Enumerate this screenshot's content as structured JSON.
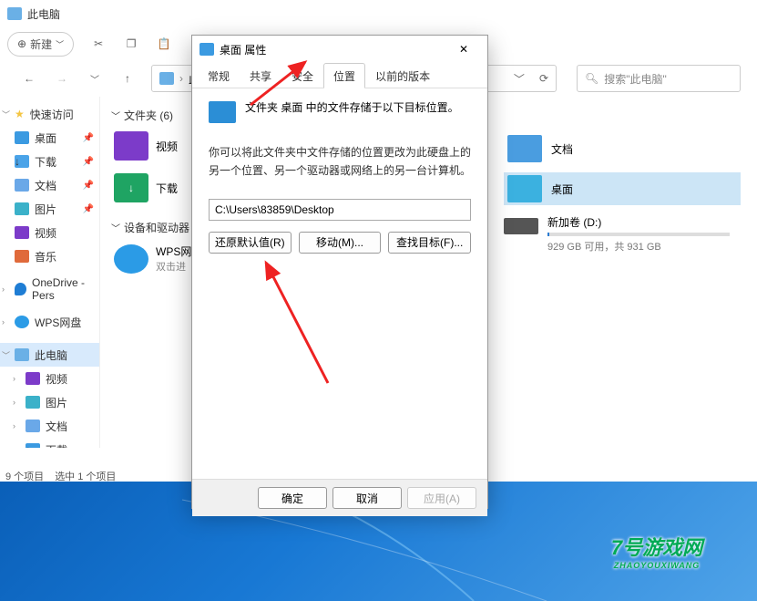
{
  "explorer": {
    "title": "此电脑",
    "new_btn": "新建",
    "breadcrumb": "此电脑",
    "search_placeholder": "搜索\"此电脑\""
  },
  "sidebar": {
    "quick": "快速访问",
    "items": [
      "桌面",
      "下载",
      "文档",
      "图片",
      "视频",
      "音乐"
    ],
    "onedrive": "OneDrive - Pers",
    "wps": "WPS网盘",
    "thispc": "此电脑",
    "sub": [
      "视频",
      "图片",
      "文档",
      "下载"
    ]
  },
  "content": {
    "folders_hdr": "文件夹 (6)",
    "devices_hdr": "设备和驱动器",
    "video": "视频",
    "download": "下载",
    "wps": "WPS网",
    "wps_sub": "双击进",
    "docs": "文档",
    "desktop": "桌面",
    "drive_name": "新加卷 (D:)",
    "drive_sub": "929 GB 可用，共 931 GB"
  },
  "dialog": {
    "title": "桌面 属性",
    "tabs": [
      "常规",
      "共享",
      "安全",
      "位置",
      "以前的版本"
    ],
    "active_tab": 3,
    "row1": "文件夹 桌面 中的文件存储于以下目标位置。",
    "desc": "你可以将此文件夹中文件存储的位置更改为此硬盘上的另一个位置、另一个驱动器或网络上的另一台计算机。",
    "path": "C:\\Users\\83859\\Desktop",
    "btn_restore": "还原默认值(R)",
    "btn_move": "移动(M)...",
    "btn_find": "查找目标(F)...",
    "ok": "确定",
    "cancel": "取消",
    "apply": "应用(A)"
  },
  "status": {
    "left": "9 个项目",
    "right": "选中 1 个项目"
  },
  "watermark": {
    "main": "7号游戏网",
    "sub": "ZHAOYOUXIWANG"
  }
}
